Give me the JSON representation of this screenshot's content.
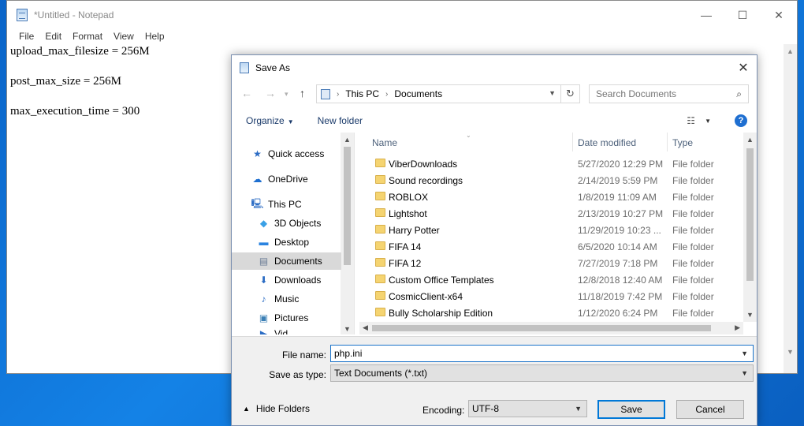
{
  "notepad": {
    "title": "*Untitled - Notepad",
    "menu": [
      "File",
      "Edit",
      "Format",
      "View",
      "Help"
    ],
    "lines": [
      "upload_max_filesize = 256M",
      "",
      "post_max_size = 256M",
      "",
      "max_execution_time = 300"
    ],
    "controls": {
      "minimize": "—",
      "maximize": "☐",
      "close": "✕"
    }
  },
  "dialog": {
    "title": "Save As",
    "close": "✕",
    "address": {
      "crumbs": [
        "This PC",
        "Documents"
      ]
    },
    "search": {
      "placeholder": "Search Documents"
    },
    "toolbar": {
      "organize": "Organize",
      "new_folder": "New folder",
      "help": "?"
    },
    "nav_items": [
      {
        "label": "Quick access",
        "icon": "star-icon",
        "glyph": "★",
        "color": "#2b6cc4",
        "indent": 1
      },
      {
        "label": "OneDrive",
        "icon": "cloud-icon",
        "glyph": "☁",
        "color": "#1e6fd0",
        "indent": 1
      },
      {
        "label": "This PC",
        "icon": "computer-icon",
        "glyph": "🖳",
        "color": "#2b6cc4",
        "indent": 1
      },
      {
        "label": "3D Objects",
        "icon": "cube-icon",
        "glyph": "◆",
        "color": "#3aa0e6",
        "indent": 2
      },
      {
        "label": "Desktop",
        "icon": "desktop-icon",
        "glyph": "▬",
        "color": "#2b84e0",
        "indent": 2
      },
      {
        "label": "Documents",
        "icon": "document-icon",
        "glyph": "▤",
        "color": "#6b7d96",
        "indent": 2,
        "selected": true
      },
      {
        "label": "Downloads",
        "icon": "download-icon",
        "glyph": "⬇",
        "color": "#2b6cc4",
        "indent": 2
      },
      {
        "label": "Music",
        "icon": "music-icon",
        "glyph": "♪",
        "color": "#2b6cc4",
        "indent": 2
      },
      {
        "label": "Pictures",
        "icon": "pictures-icon",
        "glyph": "▣",
        "color": "#3b7fb5",
        "indent": 2
      },
      {
        "label": "Vid",
        "icon": "videos-icon",
        "glyph": "▶",
        "color": "#2b6cc4",
        "indent": 2
      }
    ],
    "columns": {
      "name": "Name",
      "date": "Date modified",
      "type": "Type"
    },
    "files": [
      {
        "name": "ViberDownloads",
        "date": "5/27/2020 12:29 PM",
        "type": "File folder"
      },
      {
        "name": "Sound recordings",
        "date": "2/14/2019 5:59 PM",
        "type": "File folder"
      },
      {
        "name": "ROBLOX",
        "date": "1/8/2019 11:09 AM",
        "type": "File folder"
      },
      {
        "name": "Lightshot",
        "date": "2/13/2019 10:27 PM",
        "type": "File folder"
      },
      {
        "name": "Harry Potter",
        "date": "11/29/2019 10:23 ...",
        "type": "File folder"
      },
      {
        "name": "FIFA 14",
        "date": "6/5/2020 10:14 AM",
        "type": "File folder"
      },
      {
        "name": "FIFA 12",
        "date": "7/27/2019 7:18 PM",
        "type": "File folder"
      },
      {
        "name": "Custom Office Templates",
        "date": "12/8/2018 12:40 AM",
        "type": "File folder"
      },
      {
        "name": "CosmicClient-x64",
        "date": "11/18/2019 7:42 PM",
        "type": "File folder"
      },
      {
        "name": "Bully Scholarship Edition",
        "date": "1/12/2020 6:24 PM",
        "type": "File folder"
      }
    ],
    "filename_label": "File name:",
    "filename_value": "php.ini",
    "filetype_label": "Save as type:",
    "filetype_value": "Text Documents (*.txt)",
    "hide_folders": "Hide Folders",
    "encoding_label": "Encoding:",
    "encoding_value": "UTF-8",
    "save": "Save",
    "cancel": "Cancel"
  }
}
